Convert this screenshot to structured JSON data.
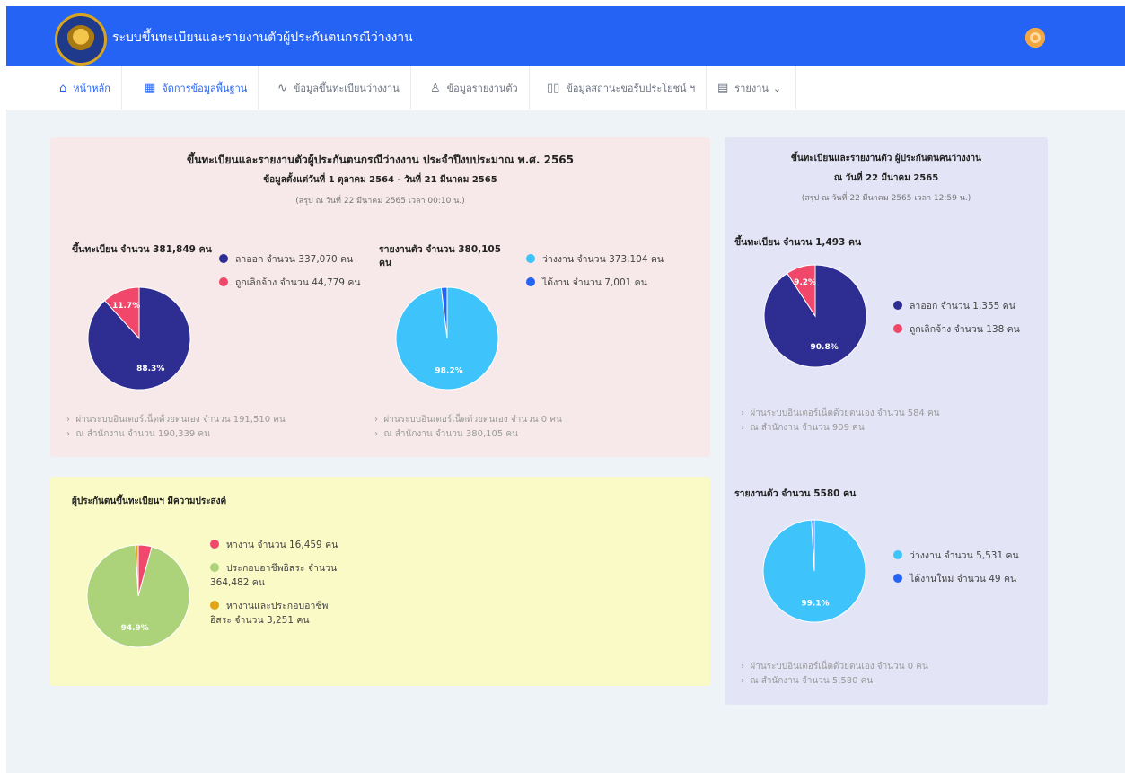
{
  "header": {
    "title": "ระบบขึ้นทะเบียนและรายงานตัวผู้ประกันตนกรณีว่างงาน",
    "logo_text": "กรมการจัดหางาน"
  },
  "nav": {
    "items": [
      {
        "label": "หน้าหลัก",
        "icon": "home-icon"
      },
      {
        "label": "จัดการข้อมูลพื้นฐาน",
        "icon": "grid-icon"
      },
      {
        "label": "ข้อมูลขึ้นทะเบียนว่างงาน",
        "icon": "activity-icon"
      },
      {
        "label": "ข้อมูลรายงานตัว",
        "icon": "user-icon"
      },
      {
        "label": "ข้อมูลสถานะขอรับประโยชน์ ฯ",
        "icon": "book-icon"
      },
      {
        "label": "รายงาน",
        "icon": "file-icon"
      }
    ]
  },
  "annual": {
    "title": "ขึ้นทะเบียนและรายงานตัวผู้ประกันตนกรณีว่างงาน ประจำปีงบประมาณ พ.ศ. 2565",
    "subtitle": "ข้อมูลตั้งแต่วันที่ 1 ตุลาคม 2564 - วันที่ 21 มีนาคม 2565",
    "summary": "(สรุป ณ วันที่ 22 มีนาคม 2565 เวลา 00:10 น.)",
    "register": {
      "label": "ขึ้นทะเบียน จำนวน 381,849 คน",
      "legend": [
        "ลาออก จำนวน 337,070 คน",
        "ถูกเลิกจ้าง จำนวน 44,779 คน"
      ],
      "notes": [
        "ผ่านระบบอินเตอร์เน็ตด้วยตนเอง จำนวน 191,510 คน",
        "ณ สำนักงาน จำนวน 190,339 คน"
      ]
    },
    "report": {
      "label": "รายงานตัว จำนวน 380,105 คน",
      "legend": [
        "ว่างงาน จำนวน 373,104 คน",
        "ได้งาน จำนวน 7,001 คน"
      ],
      "notes": [
        "ผ่านระบบอินเตอร์เน็ตด้วยตนเอง จำนวน 0 คน",
        "ณ สำนักงาน จำนวน 380,105 คน"
      ]
    }
  },
  "wishes": {
    "title": "ผู้ประกันตนขึ้นทะเบียนฯ มีความประสงค์",
    "legend": [
      "หางาน จำนวน 16,459 คน",
      "ประกอบอาชีพอิสระ จำนวน 364,482 คน",
      "หางานและประกอบอาชีพอิสระ จำนวน 3,251 คน"
    ]
  },
  "daily": {
    "title": "ขึ้นทะเบียนและรายงานตัว ผู้ประกันตนคนว่างงาน",
    "subtitle": "ณ วันที่ 22 มีนาคม 2565",
    "summary": "(สรุป ณ วันที่ 22 มีนาคม 2565 เวลา 12:59 น.)",
    "register": {
      "label": "ขึ้นทะเบียน จำนวน 1,493 คน",
      "legend": [
        "ลาออก จำนวน 1,355 คน",
        "ถูกเลิกจ้าง จำนวน 138 คน"
      ],
      "notes": [
        "ผ่านระบบอินเตอร์เน็ตด้วยตนเอง จำนวน 584 คน",
        "ณ สำนักงาน จำนวน 909 คน"
      ]
    },
    "report": {
      "label": "รายงานตัว จำนวน 5580 คน",
      "legend": [
        "ว่างงาน จำนวน 5,531 คน",
        "ได้งานใหม่ จำนวน 49 คน"
      ],
      "notes": [
        "ผ่านระบบอินเตอร์เน็ตด้วยตนเอง จำนวน 0 คน",
        "ณ สำนักงาน จำนวน 5,580 คน"
      ]
    }
  },
  "colors": {
    "header": "#2563f5",
    "navy": "#2e2d92",
    "pink": "#f0476a",
    "cyan": "#3ec3fb",
    "blue": "#2563f5",
    "green": "#acd37a",
    "gold": "#e0a416"
  },
  "chart_data": [
    {
      "type": "pie",
      "categories": [
        "ลาออก",
        "ถูกเลิกจ้าง"
      ],
      "values": [
        337070,
        44779
      ],
      "labels": [
        "88.3%",
        "11.7%"
      ]
    },
    {
      "type": "pie",
      "categories": [
        "ว่างงาน",
        "ได้งาน"
      ],
      "values": [
        373104,
        7001
      ],
      "labels": [
        "98.2%",
        ""
      ]
    },
    {
      "type": "pie",
      "categories": [
        "หางาน",
        "ประกอบอาชีพอิสระ",
        "หางานและประกอบอาชีพอิสระ"
      ],
      "values": [
        16459,
        364482,
        3251
      ],
      "labels": [
        "",
        "94.9%",
        ""
      ]
    },
    {
      "type": "pie",
      "categories": [
        "ลาออก",
        "ถูกเลิกจ้าง"
      ],
      "values": [
        1355,
        138
      ],
      "labels": [
        "90.8%",
        "9.2%"
      ]
    },
    {
      "type": "pie",
      "categories": [
        "ว่างงาน",
        "ได้งานใหม่"
      ],
      "values": [
        5531,
        49
      ],
      "labels": [
        "99.1%",
        ""
      ]
    }
  ]
}
